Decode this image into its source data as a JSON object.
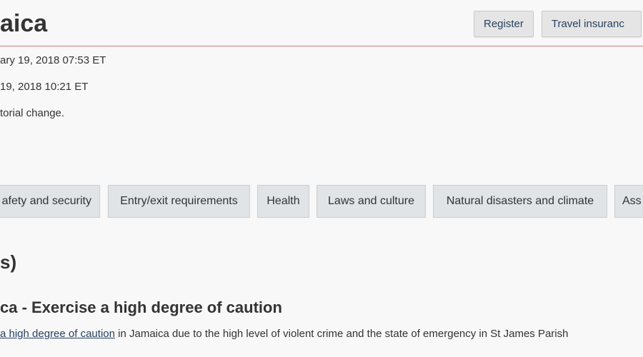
{
  "header": {
    "title": "aica",
    "register_label": "Register",
    "travel_insurance_label": "Travel insuranc"
  },
  "meta": {
    "line1": "ary 19, 2018 07:53 ET",
    "line2": "19, 2018 10:21 ET",
    "line3": "torial change."
  },
  "tabs": [
    {
      "label": "afety and security"
    },
    {
      "label": "Entry/exit requirements"
    },
    {
      "label": "Health"
    },
    {
      "label": "Laws and culture"
    },
    {
      "label": "Natural disasters and climate"
    },
    {
      "label": "Ass"
    }
  ],
  "section": {
    "heading": "s)"
  },
  "advisory": {
    "heading": "ca - Exercise a high degree of caution",
    "link_text": "a high degree of caution",
    "body_text": " in Jamaica due to the high level of violent crime and the state of emergency in St James Parish"
  },
  "colors": {
    "accent_divider": "#d3080c",
    "link": "#284162",
    "tab_bg": "#e1e4e7",
    "button_bg": "#e5e5e5"
  }
}
